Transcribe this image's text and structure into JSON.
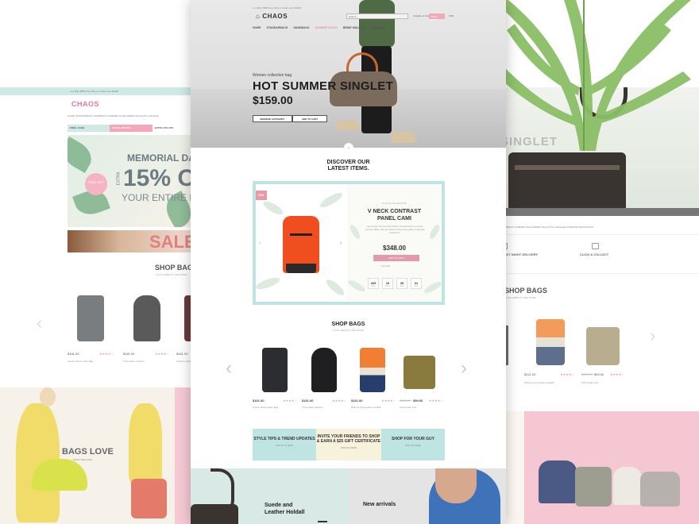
{
  "left_page": {
    "phone": "+1 (123) 4588",
    "shipping": "Free Ship on Order over $1000",
    "logo": "CHAOS",
    "nav": "HOME  STANDARBACK  HANDBACK  SUMMER SALES  BRIDE WALLETS  LUGGAGE",
    "offers": [
      "FINAL CASH",
      "EXTRA 15% OFF",
      "EXTRA 15% OFF"
    ],
    "hero_title": "MEMORIAL DA",
    "hero_extra": "EXTRA",
    "hero_pct": "15% O",
    "hero_sub": "YOUR ENTIRE PU",
    "badge": "FREE GIFT",
    "sale": "SALE",
    "shop_bags": "SHOP BAGS",
    "shop_bags_sub": "CLICK HERE TO SEE MORE",
    "products": [
      {
        "price": "$161.00",
        "name": "Suede Tassel Hobo Bag"
      },
      {
        "price": "$161.00",
        "name": "TSt Leather Satchel"
      },
      {
        "price": "$161.00",
        "name": "Suede Leather"
      }
    ],
    "bags_love": "BAGS LOVE",
    "bags_love_sub": "SHOP THE LOOK"
  },
  "right_page": {
    "hero_title": "SINGLET",
    "nav": "HANDBACK  SUMMER SALES  BRIDE WALLETS  LUGGAGE  SUNDRIES  BACKPACKS",
    "features": [
      "NEXT NIGHT DELIVERY",
      "CLICK & COLLECT"
    ],
    "shop_bags": "SHOP BAGS",
    "shop_bags_sub": "CLICK HERE TO SEE MORE",
    "products": [
      {
        "price": "$121.00",
        "name": "Buttons and Leather Holdall"
      },
      {
        "price": "$99.00",
        "old": "$105.00",
        "name": "Soft Suede Tote"
      }
    ]
  },
  "center_page": {
    "logo": "CHAOS",
    "phone": "+1 (123) 4588",
    "shipping": "Free Ship on Order over $1000",
    "search_placeholder": "Search...",
    "account": "Unicade or Register",
    "cart": "SHOP CART",
    "currency": "USD",
    "nav": [
      "HOME",
      "STANDARBACK",
      "HANDBACK",
      "SUMMER SALES",
      "BRIDE WALLETS",
      "LUGGAGE"
    ],
    "hero": {
      "kicker": "Women collection bag",
      "title": "HOT SUMMER SINGLET",
      "price": "$159.00",
      "btn_browse": "BROWSE CATEGORY",
      "btn_cart": "ADD TO CART"
    },
    "discover_line1": "DISCOVER OUR",
    "discover_line2": "LATEST ITEMS.",
    "featured": {
      "hot": "HOT",
      "brand": "CHAOS COLLECTION",
      "title_line1": "V NECK CONTRAST",
      "title_line2": "PANEL CAMI",
      "desc": "Lorem ipsum has been the industry's standard dummy text ever since the 1500s, when an unknown printer took a galley of type and scrambled it.",
      "price": "$348.00",
      "add_to_cart": "ADD TO CART",
      "share": "SHARE",
      "countdown": [
        {
          "value": "265",
          "unit": "Days"
        },
        {
          "value": "16",
          "unit": "Hours"
        },
        {
          "value": "35",
          "unit": "Mins"
        },
        {
          "value": "31",
          "unit": "Secs"
        }
      ]
    },
    "shop_bags": "SHOP BAGS",
    "shop_bags_sub": "CLICK HERE TO SEE MORE",
    "products": [
      {
        "price": "$161.00",
        "old": "",
        "name": "Suede Tassel Hobo Bag"
      },
      {
        "price": "$161.00",
        "old": "",
        "name": "TSt Leather Satchel"
      },
      {
        "price": "$161.00",
        "old": "",
        "name": "Buttons and Leather Holdall"
      },
      {
        "price": "$99.00",
        "old": "$105.00",
        "name": "Soft Suede Tote"
      }
    ],
    "promos": [
      {
        "title": "STYLE TIPS & TREND UPDATES",
        "sub": "SIGN UP TO NEWS"
      },
      {
        "title": "INVITE YOUR FRIENDS TO SHOP & EARN A $25 GIFT CERTIFICATE",
        "sub": "FIND OUT MORE"
      },
      {
        "title": "SHOP FOR YOUR GUY",
        "sub": "FIND OUT MORE"
      }
    ],
    "bottom": {
      "left_title_1": "Suede and",
      "left_title_2": "Leather Holdall",
      "right_title": "New arrivals"
    }
  },
  "colors": {
    "accent_pink": "#e59aa9",
    "mint": "#bfe5e2",
    "cream": "#f6f2dc",
    "orange_bag": "#f04e1f"
  },
  "rating": "★★★★☆"
}
